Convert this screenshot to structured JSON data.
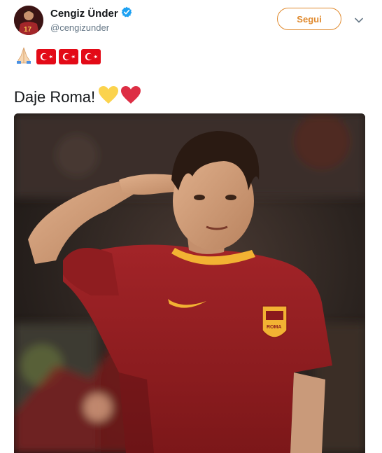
{
  "author": {
    "display_name": "Cengiz Ünder",
    "handle": "@cengizunder",
    "avatar_jersey_number": "17"
  },
  "actions": {
    "follow_label": "Segui"
  },
  "tweet": {
    "text": "Daje Roma!",
    "flags_row": [
      "pray-emoji",
      "turkey-flag",
      "turkey-flag",
      "turkey-flag"
    ],
    "trailing_emojis": [
      "yellow-heart",
      "red-heart"
    ]
  },
  "media": {
    "badge_text": "ROMA"
  },
  "colors": {
    "accent": "#e08a2e",
    "verified": "#1da1f2",
    "turkey_red": "#e30a17",
    "jersey": "#8b1a1d"
  }
}
